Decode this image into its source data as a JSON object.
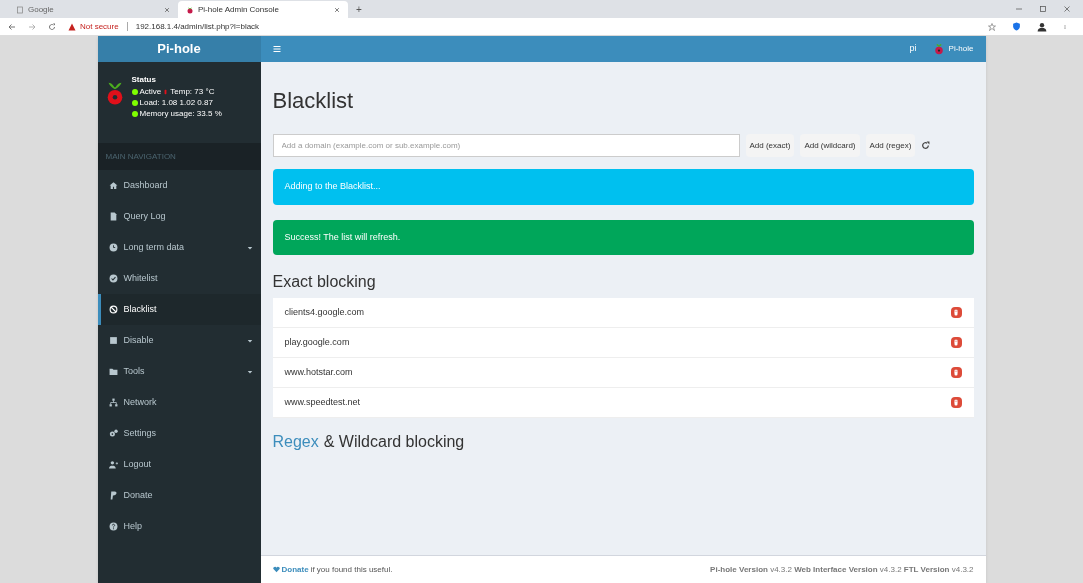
{
  "browser": {
    "tabs": [
      {
        "title": "Google",
        "selected": false
      },
      {
        "title": "Pi-hole Admin Console",
        "selected": true
      }
    ],
    "new_tab": "+",
    "security": "Not secure",
    "url": "192.168.1.4/admin/list.php?l=black"
  },
  "sidebar": {
    "brand": "Pi-hole",
    "status": {
      "title": "Status",
      "active": "Active",
      "temp": "Temp: 73 °C",
      "load": "Load: 1.08 1.02 0.87",
      "memory": "Memory usage: 33.5 %"
    },
    "nav_header": "MAIN NAVIGATION",
    "items": [
      {
        "label": "Dashboard",
        "selected": false,
        "expandable": false
      },
      {
        "label": "Query Log",
        "selected": false,
        "expandable": false
      },
      {
        "label": "Long term data",
        "selected": false,
        "expandable": true
      },
      {
        "label": "Whitelist",
        "selected": false,
        "expandable": false
      },
      {
        "label": "Blacklist",
        "selected": true,
        "expandable": false
      },
      {
        "label": "Disable",
        "selected": false,
        "expandable": true
      },
      {
        "label": "Tools",
        "selected": false,
        "expandable": true
      },
      {
        "label": "Network",
        "selected": false,
        "expandable": false
      },
      {
        "label": "Settings",
        "selected": false,
        "expandable": false
      },
      {
        "label": "Logout",
        "selected": false,
        "expandable": false
      },
      {
        "label": "Donate",
        "selected": false,
        "expandable": false
      },
      {
        "label": "Help",
        "selected": false,
        "expandable": false
      }
    ]
  },
  "header": {
    "hostname": "pi",
    "user": "Pi-hole"
  },
  "page": {
    "title": "Blacklist",
    "domain_input": {
      "placeholder": "Add a domain (example.com or sub.example.com)"
    },
    "buttons": [
      "Add (exact)",
      "Add (wildcard)",
      "Add (regex)"
    ],
    "alerts": [
      {
        "kind": "info",
        "text": "Adding to the Blacklist..."
      },
      {
        "kind": "success",
        "text": "Success! The list will refresh."
      }
    ],
    "exact_heading": "Exact blocking",
    "exact_domains": [
      "clients4.google.com",
      "play.google.com",
      "www.hotstar.com",
      "www.speedtest.net"
    ],
    "regex_heading_link": "Regex",
    "regex_heading_rest": "& Wildcard blocking"
  },
  "footer": {
    "donate_link": "Donate",
    "donate_text": "if you found this useful.",
    "versions": "**Pi-hole Version** v4.3.2 **Web Interface Version** v4.3.2 **FTL Version** v4.3.2"
  }
}
